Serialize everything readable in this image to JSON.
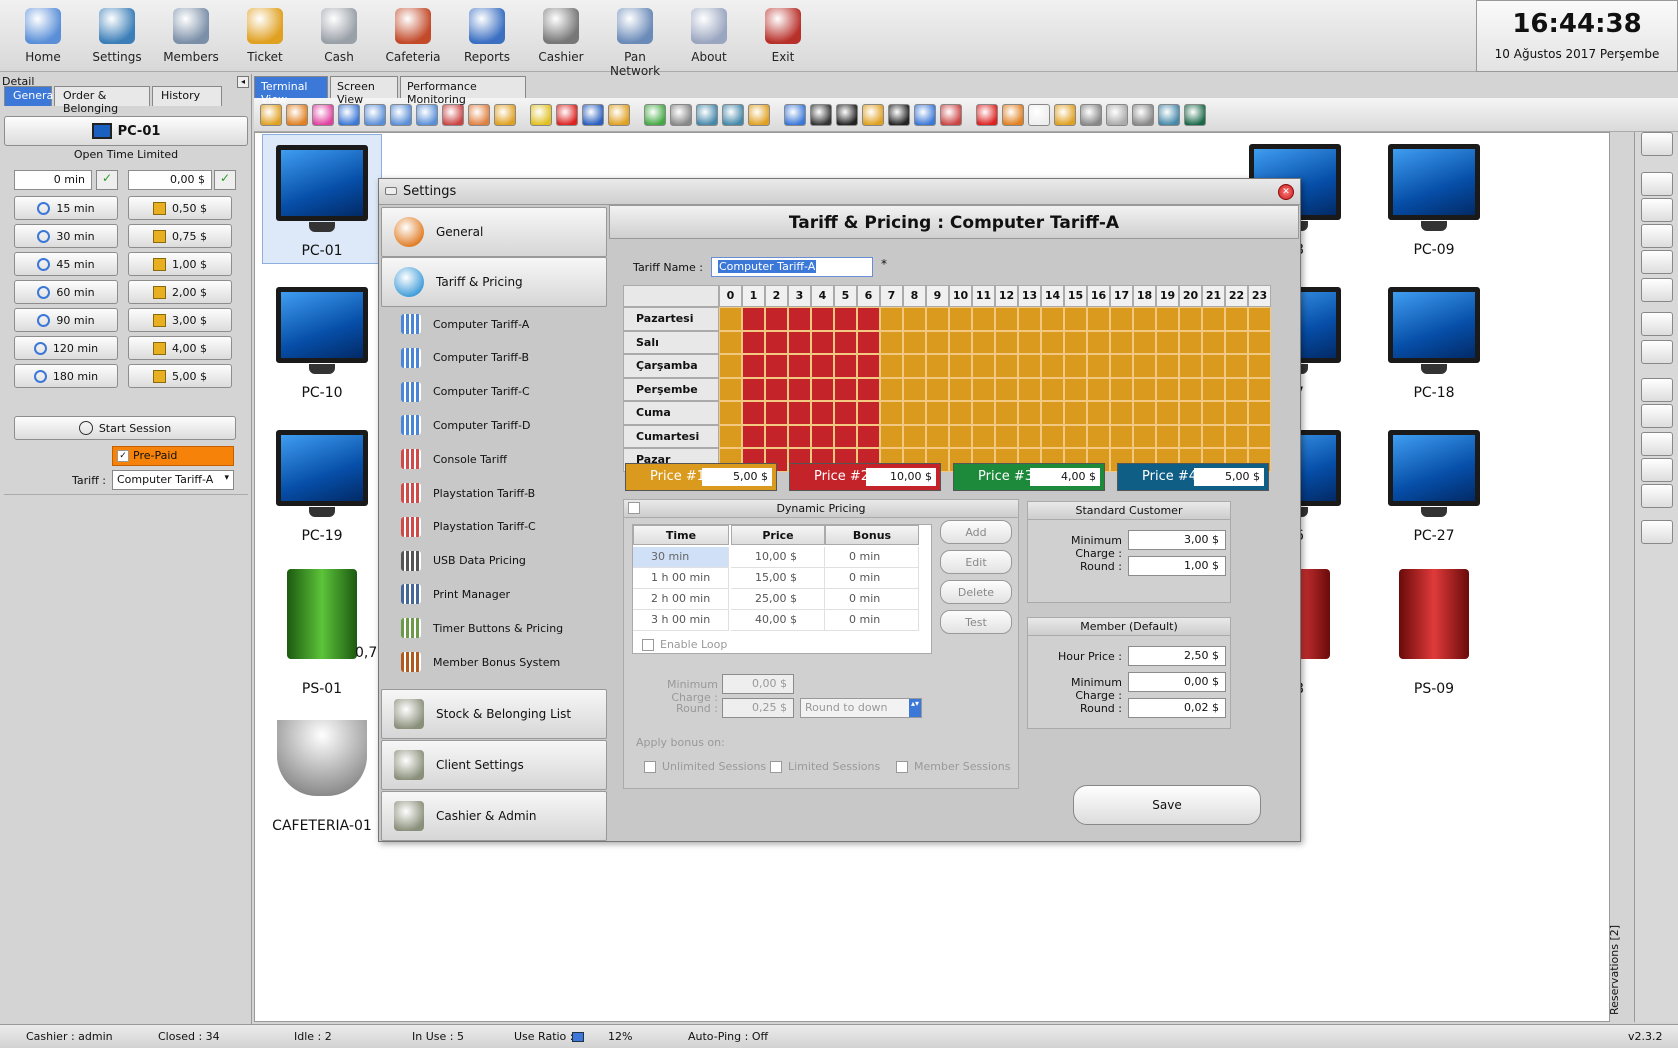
{
  "toolbar": {
    "items": [
      {
        "label": "Home",
        "icon": "home-icon"
      },
      {
        "label": "Settings",
        "icon": "settings-icon"
      },
      {
        "label": "Members",
        "icon": "members-icon"
      },
      {
        "label": "Ticket",
        "icon": "ticket-icon"
      },
      {
        "label": "Cash",
        "icon": "cash-register-icon"
      },
      {
        "label": "Cafeteria",
        "icon": "cafeteria-icon"
      },
      {
        "label": "Reports",
        "icon": "reports-icon"
      },
      {
        "label": "Cashier",
        "icon": "cashier-icon"
      },
      {
        "label": "Pan Network",
        "icon": "globe-icon"
      },
      {
        "label": "About",
        "icon": "info-icon"
      },
      {
        "label": "Exit",
        "icon": "exit-icon"
      }
    ]
  },
  "clock": {
    "time": "16:44:38",
    "date": "10 Ağustos 2017 Perşembe"
  },
  "detail": {
    "title": "Detail",
    "tabs": [
      "General",
      "Order & Belonging",
      "History"
    ],
    "pc_name": "PC-01",
    "mode": "Open Time Limited",
    "time_input": "0 min",
    "money_input": "0,00 $",
    "time_buttons": [
      "15 min",
      "30 min",
      "45 min",
      "60 min",
      "90 min",
      "120 min",
      "180 min"
    ],
    "money_buttons": [
      "0,50 $",
      "0,75 $",
      "1,00 $",
      "2,00 $",
      "3,00 $",
      "4,00 $",
      "5,00 $"
    ],
    "start_label": "Start Session",
    "prepaid_label": "Pre-Paid",
    "tariff_label": "Tariff :",
    "tariff_value": "Computer Tariff-A"
  },
  "view_tabs": [
    "Terminal View",
    "Screen View",
    "Performance Monitoring"
  ],
  "terminals": [
    {
      "name": "PC-01",
      "type": "pc",
      "col": 0,
      "row": 0
    },
    {
      "name": "08",
      "type": "pc",
      "col": 7,
      "row": 0
    },
    {
      "name": "PC-09",
      "type": "pc",
      "col": 8,
      "row": 0
    },
    {
      "name": "PC-10",
      "type": "pc",
      "col": 0,
      "row": 1
    },
    {
      "name": "17",
      "type": "pc",
      "col": 7,
      "row": 1
    },
    {
      "name": "PC-18",
      "type": "pc",
      "col": 8,
      "row": 1
    },
    {
      "name": "PC-19",
      "type": "pc",
      "col": 0,
      "row": 2
    },
    {
      "name": "26",
      "type": "pc",
      "col": 7,
      "row": 2
    },
    {
      "name": "PC-27",
      "type": "pc",
      "col": 8,
      "row": 2
    },
    {
      "name": "PS-01",
      "type": "ps-green",
      "col": 0,
      "row": 3
    },
    {
      "name": "08",
      "type": "ps-red",
      "col": 7,
      "row": 3
    },
    {
      "name": "PS-09",
      "type": "ps-red",
      "col": 8,
      "row": 3
    },
    {
      "name": "CAFETERIA-01",
      "type": "cup",
      "col": 0,
      "row": 4
    }
  ],
  "ps01_price": "0,75",
  "settings": {
    "title": "Settings",
    "nav_top": [
      {
        "label": "General",
        "icon": "gear-icon"
      },
      {
        "label": "Tariff & Pricing",
        "icon": "clock-icon"
      }
    ],
    "nav_sub": [
      {
        "label": "Computer Tariff-A",
        "color": "#4a86d8"
      },
      {
        "label": "Computer Tariff-B",
        "color": "#4a86d8"
      },
      {
        "label": "Computer Tariff-C",
        "color": "#4a86d8"
      },
      {
        "label": "Computer Tariff-D",
        "color": "#4a86d8"
      },
      {
        "label": "Console Tariff",
        "color": "#d04a4a"
      },
      {
        "label": "Playstation Tariff-B",
        "color": "#d04a4a"
      },
      {
        "label": "Playstation Tariff-C",
        "color": "#d04a4a"
      },
      {
        "label": "USB Data Pricing",
        "color": "#555555"
      },
      {
        "label": "Print Manager",
        "color": "#446699"
      },
      {
        "label": "Timer Buttons & Pricing",
        "color": "#6a9a4a"
      },
      {
        "label": "Member Bonus System",
        "color": "#b05a20"
      }
    ],
    "nav_bottom": [
      {
        "label": "Stock & Belonging List",
        "icon": "stock-icon"
      },
      {
        "label": "Client Settings",
        "icon": "client-icon"
      },
      {
        "label": "Cashier & Admin",
        "icon": "admin-icon"
      }
    ],
    "header": "Tariff & Pricing : Computer Tariff-A",
    "tariff_name_label": "Tariff Name :",
    "tariff_name": "Computer Tariff-A",
    "asterisk": "*",
    "hours": [
      "0",
      "1",
      "2",
      "3",
      "4",
      "5",
      "6",
      "7",
      "8",
      "9",
      "10",
      "11",
      "12",
      "13",
      "14",
      "15",
      "16",
      "17",
      "18",
      "19",
      "20",
      "21",
      "22",
      "23"
    ],
    "days": [
      "Pazartesi",
      "Salı",
      "Çarşamba",
      "Perşembe",
      "Cuma",
      "Cumartesi",
      "Pazar"
    ],
    "grid": [
      1,
      2,
      2,
      2,
      2,
      2,
      2,
      1,
      1,
      1,
      1,
      1,
      1,
      1,
      1,
      1,
      1,
      1,
      1,
      1,
      1,
      1,
      1,
      1
    ],
    "grid_colors": {
      "1": "#d99a1e",
      "2": "#c4232a"
    },
    "prices": [
      {
        "label": "Price #1",
        "value": "5,00 $",
        "color": "#d99a1e"
      },
      {
        "label": "Price #2",
        "value": "10,00 $",
        "color": "#c4232a"
      },
      {
        "label": "Price #3",
        "value": "4,00 $",
        "color": "#1c8a3a"
      },
      {
        "label": "Price #4",
        "value": "5,00 $",
        "color": "#0f5e86"
      }
    ],
    "dynamic": {
      "title": "Dynamic Pricing",
      "columns": [
        "Time",
        "Price",
        "Bonus"
      ],
      "rows": [
        [
          "30 min",
          "10,00 $",
          "0 min"
        ],
        [
          "1 h 00 min",
          "15,00 $",
          "0 min"
        ],
        [
          "2 h 00 min",
          "25,00 $",
          "0 min"
        ],
        [
          "3 h 00 min",
          "40,00 $",
          "0 min"
        ]
      ],
      "buttons": [
        "Add",
        "Edit",
        "Delete",
        "Test"
      ],
      "loop_label": "Enable Loop",
      "min_charge_label": "Minimum Charge :",
      "min_charge": "0,00 $",
      "round_label": "Round :",
      "round": "0,25 $",
      "round_mode": "Round to down",
      "bonus_label": "Apply bonus on:",
      "bonus_options": [
        "Unlimited Sessions",
        "Limited Sessions",
        "Member Sessions"
      ]
    },
    "standard": {
      "title": "Standard Customer",
      "min_charge_label": "Minimum Charge :",
      "min_charge": "3,00 $",
      "round_label": "Round :",
      "round": "1,00 $"
    },
    "member": {
      "title": "Member (Default)",
      "hour_label": "Hour Price :",
      "hour": "2,50 $",
      "min_charge_label": "Minimum Charge :",
      "min_charge": "0,00 $",
      "round_label": "Round :",
      "round": "0,02 $"
    },
    "save_label": "Save"
  },
  "reservations": "Reservations [2]",
  "status": {
    "cashier": "Cashier : admin",
    "closed": "Closed : 34",
    "idle": "Idle : 2",
    "inuse": "In Use : 5",
    "ratio_label": "Use Ratio :",
    "ratio": "12%",
    "ping": "Auto-Ping : Off",
    "version": "v2.3.2"
  }
}
